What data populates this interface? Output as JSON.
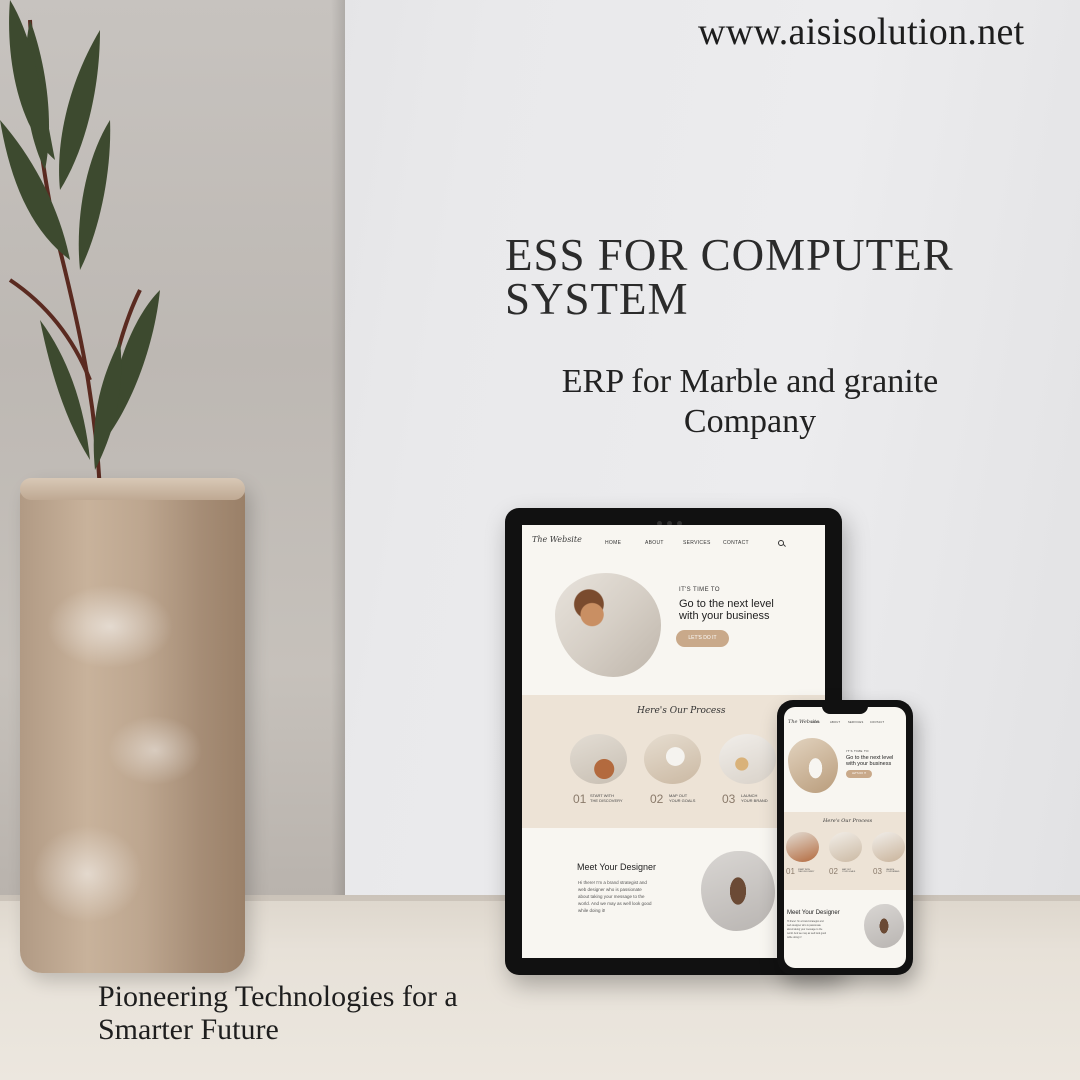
{
  "site": {
    "url": "www.aisisolution.net"
  },
  "headline": {
    "line1": "ESS FOR COMPUTER",
    "line2": "SYSTEM"
  },
  "subhead": {
    "line1": "ERP for Marble and granite",
    "line2": "Company"
  },
  "tagline": {
    "line1": "Pioneering Technologies for a",
    "line2": "Smarter Future"
  },
  "mockup": {
    "logo": "The Website",
    "nav": [
      "HOME",
      "ABOUT",
      "SERVICES",
      "CONTACT"
    ],
    "hero": {
      "eyebrow": "IT'S TIME TO",
      "title_line1": "Go to the next level",
      "title_line2": "with your business",
      "cta": "LET'S DO IT"
    },
    "process": {
      "title": "Here's Our Process",
      "steps": [
        {
          "num": "01",
          "label_line1": "START WITH",
          "label_line2": "THE DISCOVERY"
        },
        {
          "num": "02",
          "label_line1": "MAP OUT",
          "label_line2": "YOUR GOALS"
        },
        {
          "num": "03",
          "label_line1": "LAUNCH",
          "label_line2": "YOUR BRAND"
        }
      ]
    },
    "designer": {
      "title": "Meet Your Designer",
      "body_line1": "Hi there! I'm a brand strategist and",
      "body_line2": "web designer who is passionate",
      "body_line3": "about taking your message to the",
      "body_line4": "world. And we may as well look good",
      "body_line5": "while doing it!"
    }
  },
  "colors": {
    "accent": "#c9a98a",
    "process_bg": "#ede3d6",
    "screen_bg": "#f8f6f1"
  }
}
